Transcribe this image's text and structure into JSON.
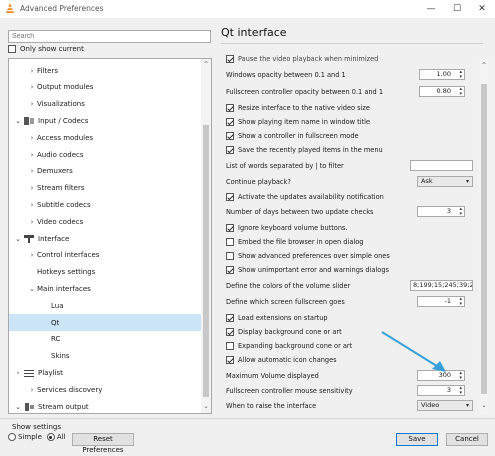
{
  "window": {
    "title": "Advanced Preferences"
  },
  "search": {
    "placeholder": "Search"
  },
  "only_show_current": {
    "label": "Only show current",
    "checked": false
  },
  "tree": {
    "items": [
      {
        "label": "Filters",
        "level": 1,
        "arrow": "›"
      },
      {
        "label": "Output modules",
        "level": 1,
        "arrow": "›"
      },
      {
        "label": "Visualizations",
        "level": 1,
        "arrow": "›"
      },
      {
        "label": "Input / Codecs",
        "level": 0,
        "arrow": "⌄",
        "icon": "input-codecs-icon"
      },
      {
        "label": "Access modules",
        "level": 1,
        "arrow": "›"
      },
      {
        "label": "Audio codecs",
        "level": 1,
        "arrow": "›"
      },
      {
        "label": "Demuxers",
        "level": 1,
        "arrow": "›"
      },
      {
        "label": "Stream filters",
        "level": 1,
        "arrow": "›"
      },
      {
        "label": "Subtitle codecs",
        "level": 1,
        "arrow": "›"
      },
      {
        "label": "Video codecs",
        "level": 1,
        "arrow": "›"
      },
      {
        "label": "Interface",
        "level": 0,
        "arrow": "⌄",
        "icon": "interface-icon"
      },
      {
        "label": "Control interfaces",
        "level": 1,
        "arrow": "›"
      },
      {
        "label": "Hotkeys settings",
        "level": 1,
        "arrow": ""
      },
      {
        "label": "Main interfaces",
        "level": 1,
        "arrow": "⌄"
      },
      {
        "label": "Lua",
        "level": 2,
        "arrow": ""
      },
      {
        "label": "Qt",
        "level": 2,
        "arrow": "",
        "selected": true
      },
      {
        "label": "RC",
        "level": 2,
        "arrow": ""
      },
      {
        "label": "Skins",
        "level": 2,
        "arrow": ""
      },
      {
        "label": "Playlist",
        "level": 0,
        "arrow": "›",
        "icon": "playlist-icon"
      },
      {
        "label": "Services discovery",
        "level": 1,
        "arrow": "›"
      },
      {
        "label": "Stream output",
        "level": 0,
        "arrow": "⌄",
        "icon": "stream-output-icon"
      }
    ]
  },
  "panel": {
    "title": "Qt interface",
    "top_partial": "Pause the video playback when minimized",
    "opacity_label": "Windows opacity between 0.1 and 1",
    "opacity_value": "1.00",
    "fs_opacity_label": "Fullscreen controller opacity between 0.1 and 1",
    "fs_opacity_value": "0.80",
    "check_resize": "Resize interface to the native video size",
    "check_title": "Show playing item name in window title",
    "check_fs_controller": "Show a controller in fullscreen mode",
    "check_save_recent": "Save the recently played items in the menu",
    "filter_label": "List of words separated by | to filter",
    "filter_value": "",
    "continue_label": "Continue playback?",
    "continue_value": "Ask",
    "check_updates_notif": "Activate the updates availability notification",
    "days_label": "Number of days between two update checks",
    "days_value": "3",
    "check_ignore_volume": "Ignore keyboard volume buttons.",
    "check_embed": "Embed the file browser in open dialog",
    "check_advanced": "Show advanced preferences over simple ones",
    "check_unimportant": "Show unimportant error and warnings dialogs",
    "volume_colors_label": "Define the colors of the volume slider",
    "volume_colors_value": "8;199;15;245;39;29",
    "fs_screen_label": "Define which screen fullscreen goes",
    "fs_screen_value": "-1",
    "check_load_ext": "Load extensions on startup",
    "check_bg_cone": "Display background cone or art",
    "check_expanding_bg": "Expanding background cone or art",
    "check_auto_icon": "Allow automatic icon changes",
    "max_volume_label": "Maximum Volume displayed",
    "max_volume_value": "300",
    "mouse_sens_label": "Fullscreen controller mouse sensitivity",
    "mouse_sens_value": "3",
    "raise_label": "When to raise the interface",
    "raise_value": "Video"
  },
  "checks": {
    "resize": true,
    "title": true,
    "fs_controller": true,
    "save_recent": true,
    "updates_notif": true,
    "ignore_volume": true,
    "embed": false,
    "advanced": false,
    "unimportant": true,
    "load_ext": true,
    "bg_cone": true,
    "expanding_bg": false,
    "auto_icon": true
  },
  "footer": {
    "show_settings": "Show settings",
    "simple": "Simple",
    "all": "All",
    "reset": "Reset Preferences",
    "save": "Save",
    "cancel": "Cancel"
  },
  "colors": {
    "selection": "#cce4f7",
    "annotation_arrow": "#3aa0d8",
    "primary_border": "#0078d7"
  }
}
